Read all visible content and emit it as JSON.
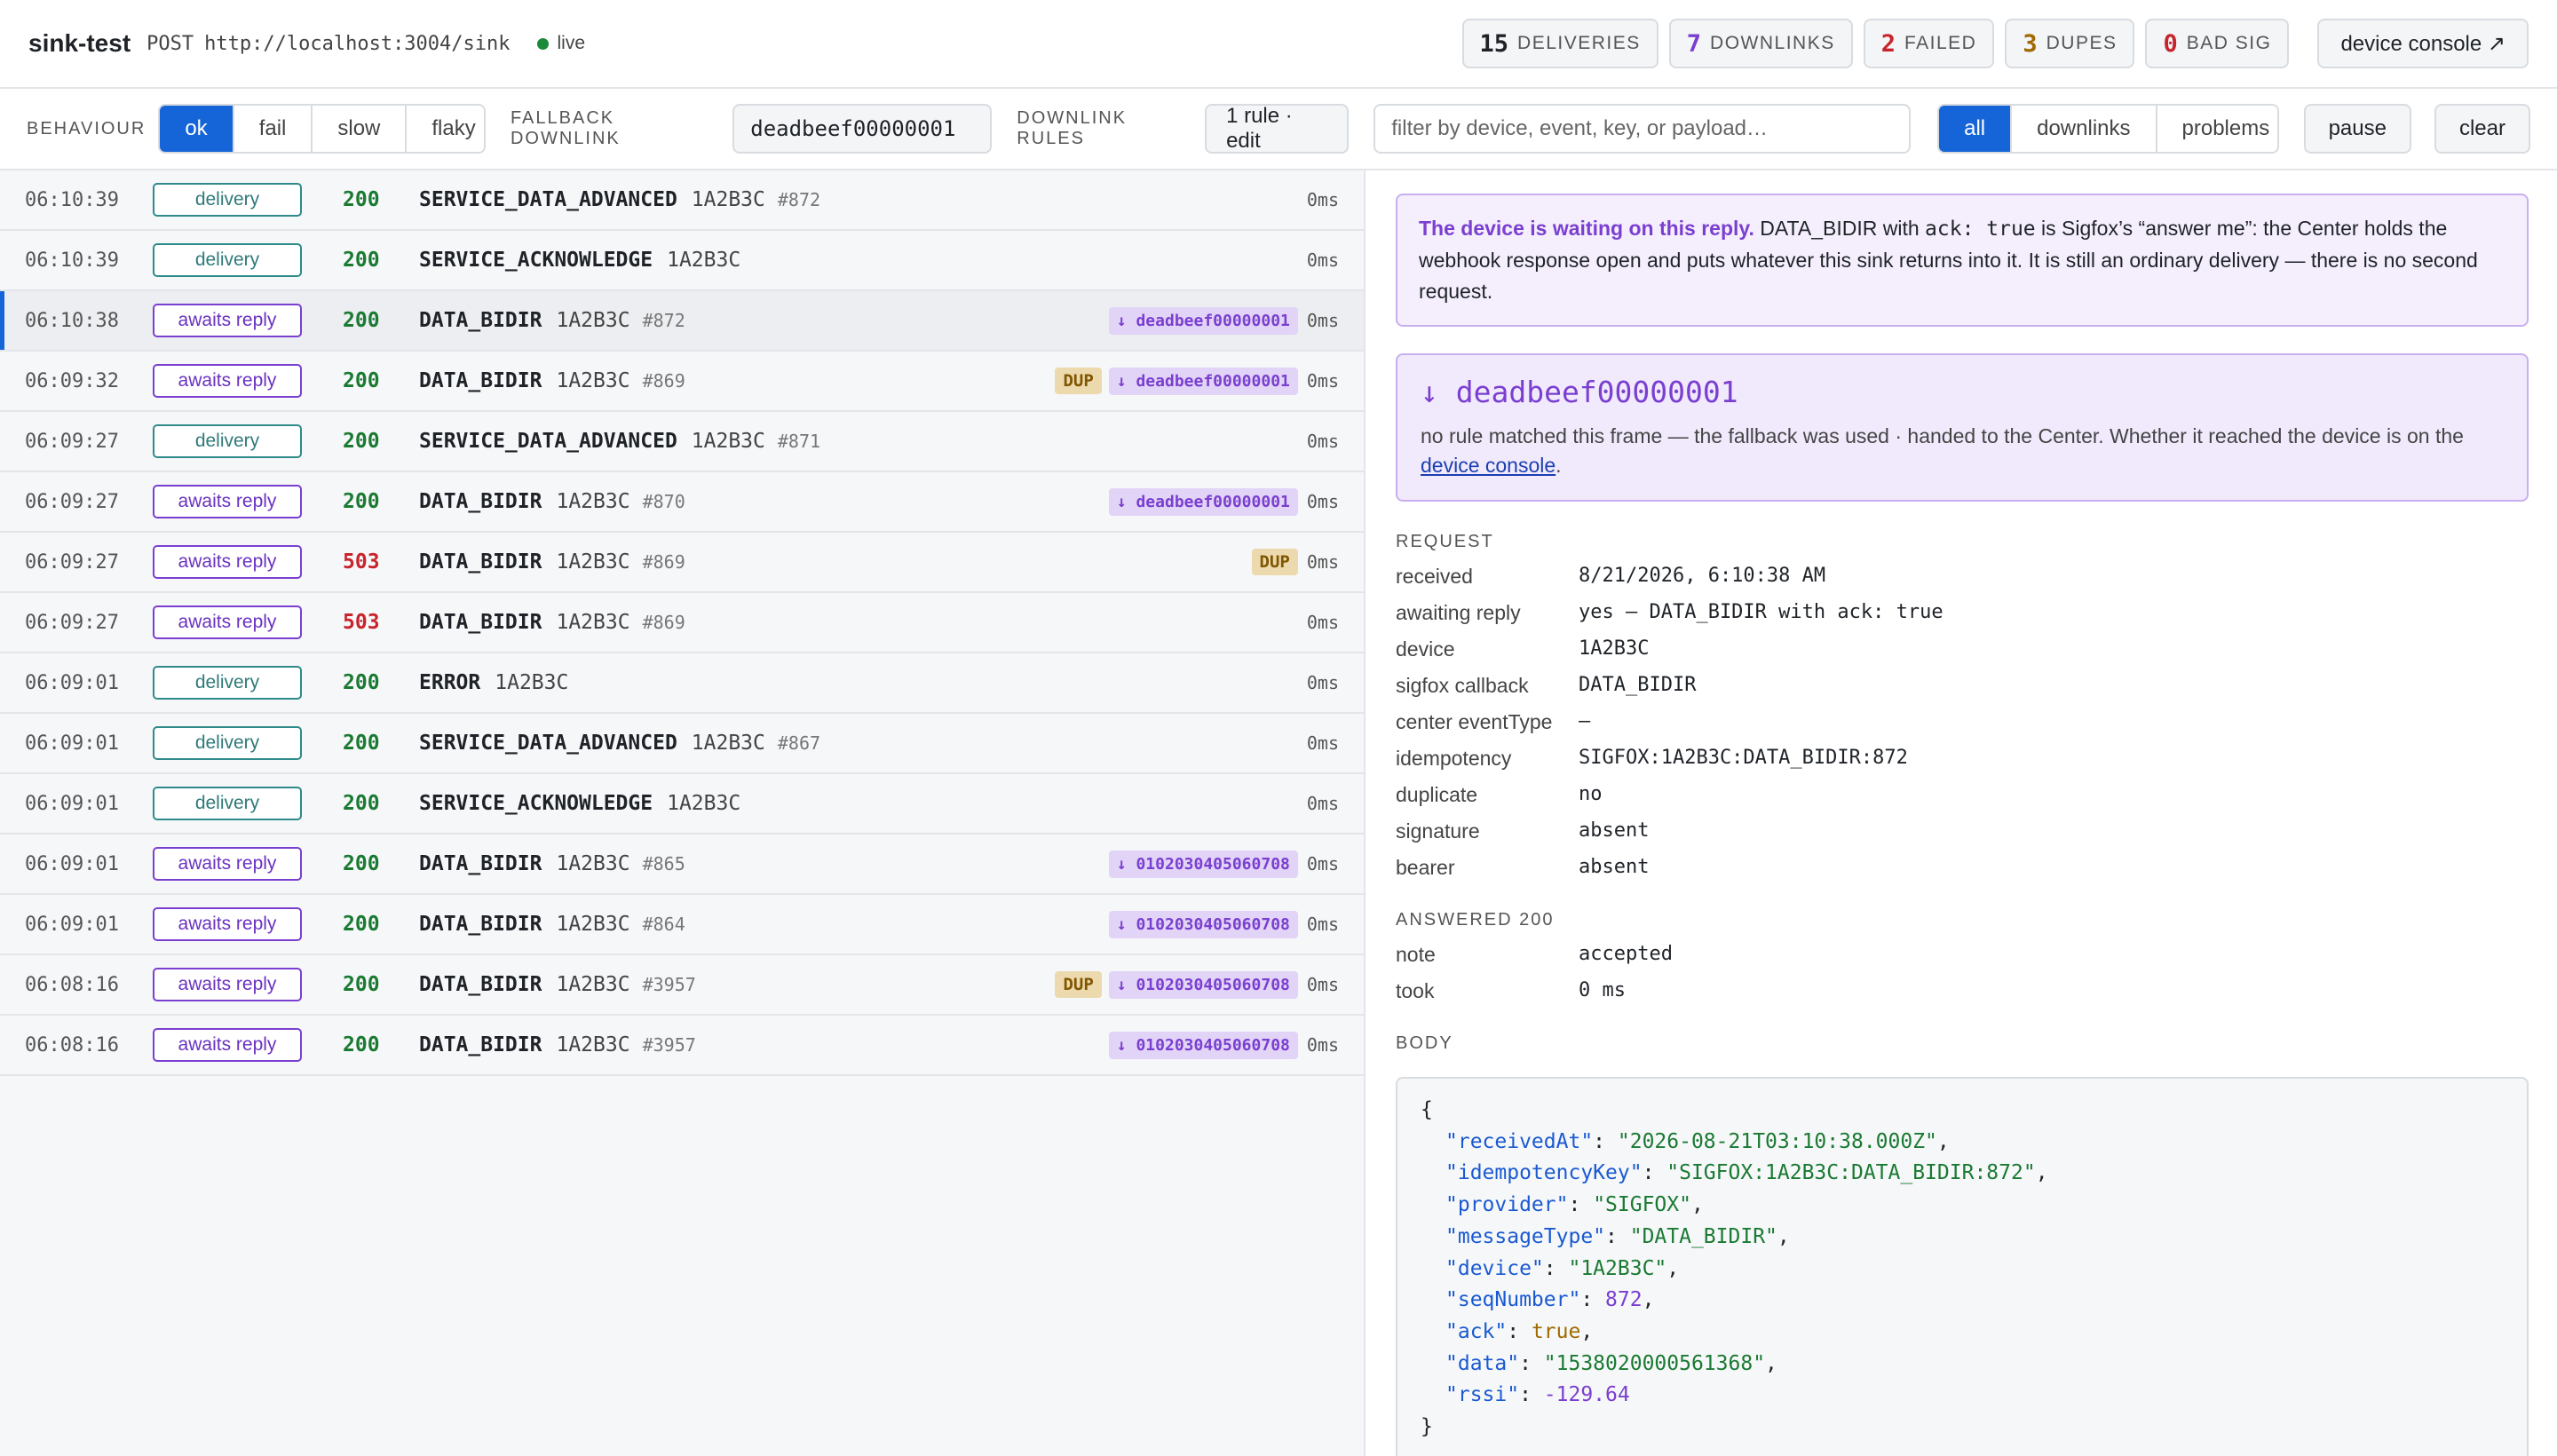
{
  "header": {
    "brand": "sink-test",
    "method": "POST",
    "url": "http://localhost:3004/sink",
    "live": "live",
    "counters": {
      "deliveries": {
        "num": "15",
        "label": "DELIVERIES"
      },
      "downlinks": {
        "num": "7",
        "label": "DOWNLINKS"
      },
      "failed": {
        "num": "2",
        "label": "FAILED"
      },
      "dupes": {
        "num": "3",
        "label": "DUPES"
      },
      "bad_sig": {
        "num": "0",
        "label": "BAD SIG"
      }
    },
    "console_button": "device console ↗"
  },
  "toolbar": {
    "behaviour_label": "BEHAVIOUR",
    "behaviour_options": [
      "ok",
      "fail",
      "slow",
      "flaky"
    ],
    "behaviour_selected": "ok",
    "fallback_label": "FALLBACK DOWNLINK",
    "fallback_value": "deadbeef00000001",
    "rules_label": "DOWNLINK RULES",
    "rules_button": "1 rule · edit",
    "filter_placeholder": "filter by device, event, key, or payload…",
    "view_options": [
      "all",
      "downlinks",
      "problems"
    ],
    "view_selected": "all",
    "pause": "pause",
    "clear": "clear"
  },
  "rows": [
    {
      "time": "06:10:39",
      "kind": "delivery",
      "status": "200",
      "event": "SERVICE_DATA_ADVANCED",
      "device": "1A2B3C",
      "seq": "#872",
      "dup": "",
      "downlink": "",
      "ms": "0ms"
    },
    {
      "time": "06:10:39",
      "kind": "delivery",
      "status": "200",
      "event": "SERVICE_ACKNOWLEDGE",
      "device": "1A2B3C",
      "seq": "",
      "dup": "",
      "downlink": "",
      "ms": "0ms"
    },
    {
      "time": "06:10:38",
      "kind": "awaits reply",
      "status": "200",
      "event": "DATA_BIDIR",
      "device": "1A2B3C",
      "seq": "#872",
      "dup": "",
      "downlink": "↓ deadbeef00000001",
      "ms": "0ms",
      "selected": true
    },
    {
      "time": "06:09:32",
      "kind": "awaits reply",
      "status": "200",
      "event": "DATA_BIDIR",
      "device": "1A2B3C",
      "seq": "#869",
      "dup": "DUP",
      "downlink": "↓ deadbeef00000001",
      "ms": "0ms"
    },
    {
      "time": "06:09:27",
      "kind": "delivery",
      "status": "200",
      "event": "SERVICE_DATA_ADVANCED",
      "device": "1A2B3C",
      "seq": "#871",
      "dup": "",
      "downlink": "",
      "ms": "0ms"
    },
    {
      "time": "06:09:27",
      "kind": "awaits reply",
      "status": "200",
      "event": "DATA_BIDIR",
      "device": "1A2B3C",
      "seq": "#870",
      "dup": "",
      "downlink": "↓ deadbeef00000001",
      "ms": "0ms"
    },
    {
      "time": "06:09:27",
      "kind": "awaits reply",
      "status": "503",
      "event": "DATA_BIDIR",
      "device": "1A2B3C",
      "seq": "#869",
      "dup": "DUP",
      "downlink": "",
      "ms": "0ms"
    },
    {
      "time": "06:09:27",
      "kind": "awaits reply",
      "status": "503",
      "event": "DATA_BIDIR",
      "device": "1A2B3C",
      "seq": "#869",
      "dup": "",
      "downlink": "",
      "ms": "0ms"
    },
    {
      "time": "06:09:01",
      "kind": "delivery",
      "status": "200",
      "event": "ERROR",
      "device": "1A2B3C",
      "seq": "",
      "dup": "",
      "downlink": "",
      "ms": "0ms"
    },
    {
      "time": "06:09:01",
      "kind": "delivery",
      "status": "200",
      "event": "SERVICE_DATA_ADVANCED",
      "device": "1A2B3C",
      "seq": "#867",
      "dup": "",
      "downlink": "",
      "ms": "0ms"
    },
    {
      "time": "06:09:01",
      "kind": "delivery",
      "status": "200",
      "event": "SERVICE_ACKNOWLEDGE",
      "device": "1A2B3C",
      "seq": "",
      "dup": "",
      "downlink": "",
      "ms": "0ms"
    },
    {
      "time": "06:09:01",
      "kind": "awaits reply",
      "status": "200",
      "event": "DATA_BIDIR",
      "device": "1A2B3C",
      "seq": "#865",
      "dup": "",
      "downlink": "↓ 0102030405060708",
      "ms": "0ms"
    },
    {
      "time": "06:09:01",
      "kind": "awaits reply",
      "status": "200",
      "event": "DATA_BIDIR",
      "device": "1A2B3C",
      "seq": "#864",
      "dup": "",
      "downlink": "↓ 0102030405060708",
      "ms": "0ms"
    },
    {
      "time": "06:08:16",
      "kind": "awaits reply",
      "status": "200",
      "event": "DATA_BIDIR",
      "device": "1A2B3C",
      "seq": "#3957",
      "dup": "DUP",
      "downlink": "↓ 0102030405060708",
      "ms": "0ms"
    },
    {
      "time": "06:08:16",
      "kind": "awaits reply",
      "status": "200",
      "event": "DATA_BIDIR",
      "device": "1A2B3C",
      "seq": "#3957",
      "dup": "",
      "downlink": "↓ 0102030405060708",
      "ms": "0ms"
    }
  ],
  "detail": {
    "notice": {
      "strong": "The device is waiting on this reply.",
      "t1": " DATA_BIDIR with ",
      "code": "ack: true",
      "t2": " is Sigfox’s “answer me”: the Center holds the webhook response open and puts whatever this sink returns into it. It is still an ordinary delivery — there is no second request."
    },
    "downlink": {
      "value": "↓ deadbeef00000001",
      "desc": "no rule matched this frame — the fallback was used · handed to the Center. Whether it reached the device is on the ",
      "link": "device console",
      "desc_end": "."
    },
    "request_title": "REQUEST",
    "request": [
      {
        "k": "received",
        "v": "8/21/2026, 6:10:38 AM"
      },
      {
        "k": "awaiting reply",
        "v": "yes — DATA_BIDIR with ack: true"
      },
      {
        "k": "device",
        "v": "1A2B3C"
      },
      {
        "k": "sigfox callback",
        "v": "DATA_BIDIR"
      },
      {
        "k": "center eventType",
        "v": "—"
      },
      {
        "k": "idempotency",
        "v": "SIGFOX:1A2B3C:DATA_BIDIR:872"
      },
      {
        "k": "duplicate",
        "v": "no"
      },
      {
        "k": "signature",
        "v": "absent"
      },
      {
        "k": "bearer",
        "v": "absent"
      }
    ],
    "answer_title": "ANSWERED 200",
    "answer": [
      {
        "k": "note",
        "v": "accepted"
      },
      {
        "k": "took",
        "v": "0 ms"
      }
    ],
    "body_title": "BODY",
    "body": [
      {
        "key": "receivedAt",
        "val": "\"2026-08-21T03:10:38.000Z\"",
        "type": "s"
      },
      {
        "key": "idempotencyKey",
        "val": "\"SIGFOX:1A2B3C:DATA_BIDIR:872\"",
        "type": "s"
      },
      {
        "key": "provider",
        "val": "\"SIGFOX\"",
        "type": "s"
      },
      {
        "key": "messageType",
        "val": "\"DATA_BIDIR\"",
        "type": "s"
      },
      {
        "key": "device",
        "val": "\"1A2B3C\"",
        "type": "s"
      },
      {
        "key": "seqNumber",
        "val": "872",
        "type": "n"
      },
      {
        "key": "ack",
        "val": "true",
        "type": "b"
      },
      {
        "key": "data",
        "val": "\"1538020000561368\"",
        "type": "s"
      },
      {
        "key": "rssi",
        "val": "-129.64",
        "type": "n"
      }
    ]
  }
}
